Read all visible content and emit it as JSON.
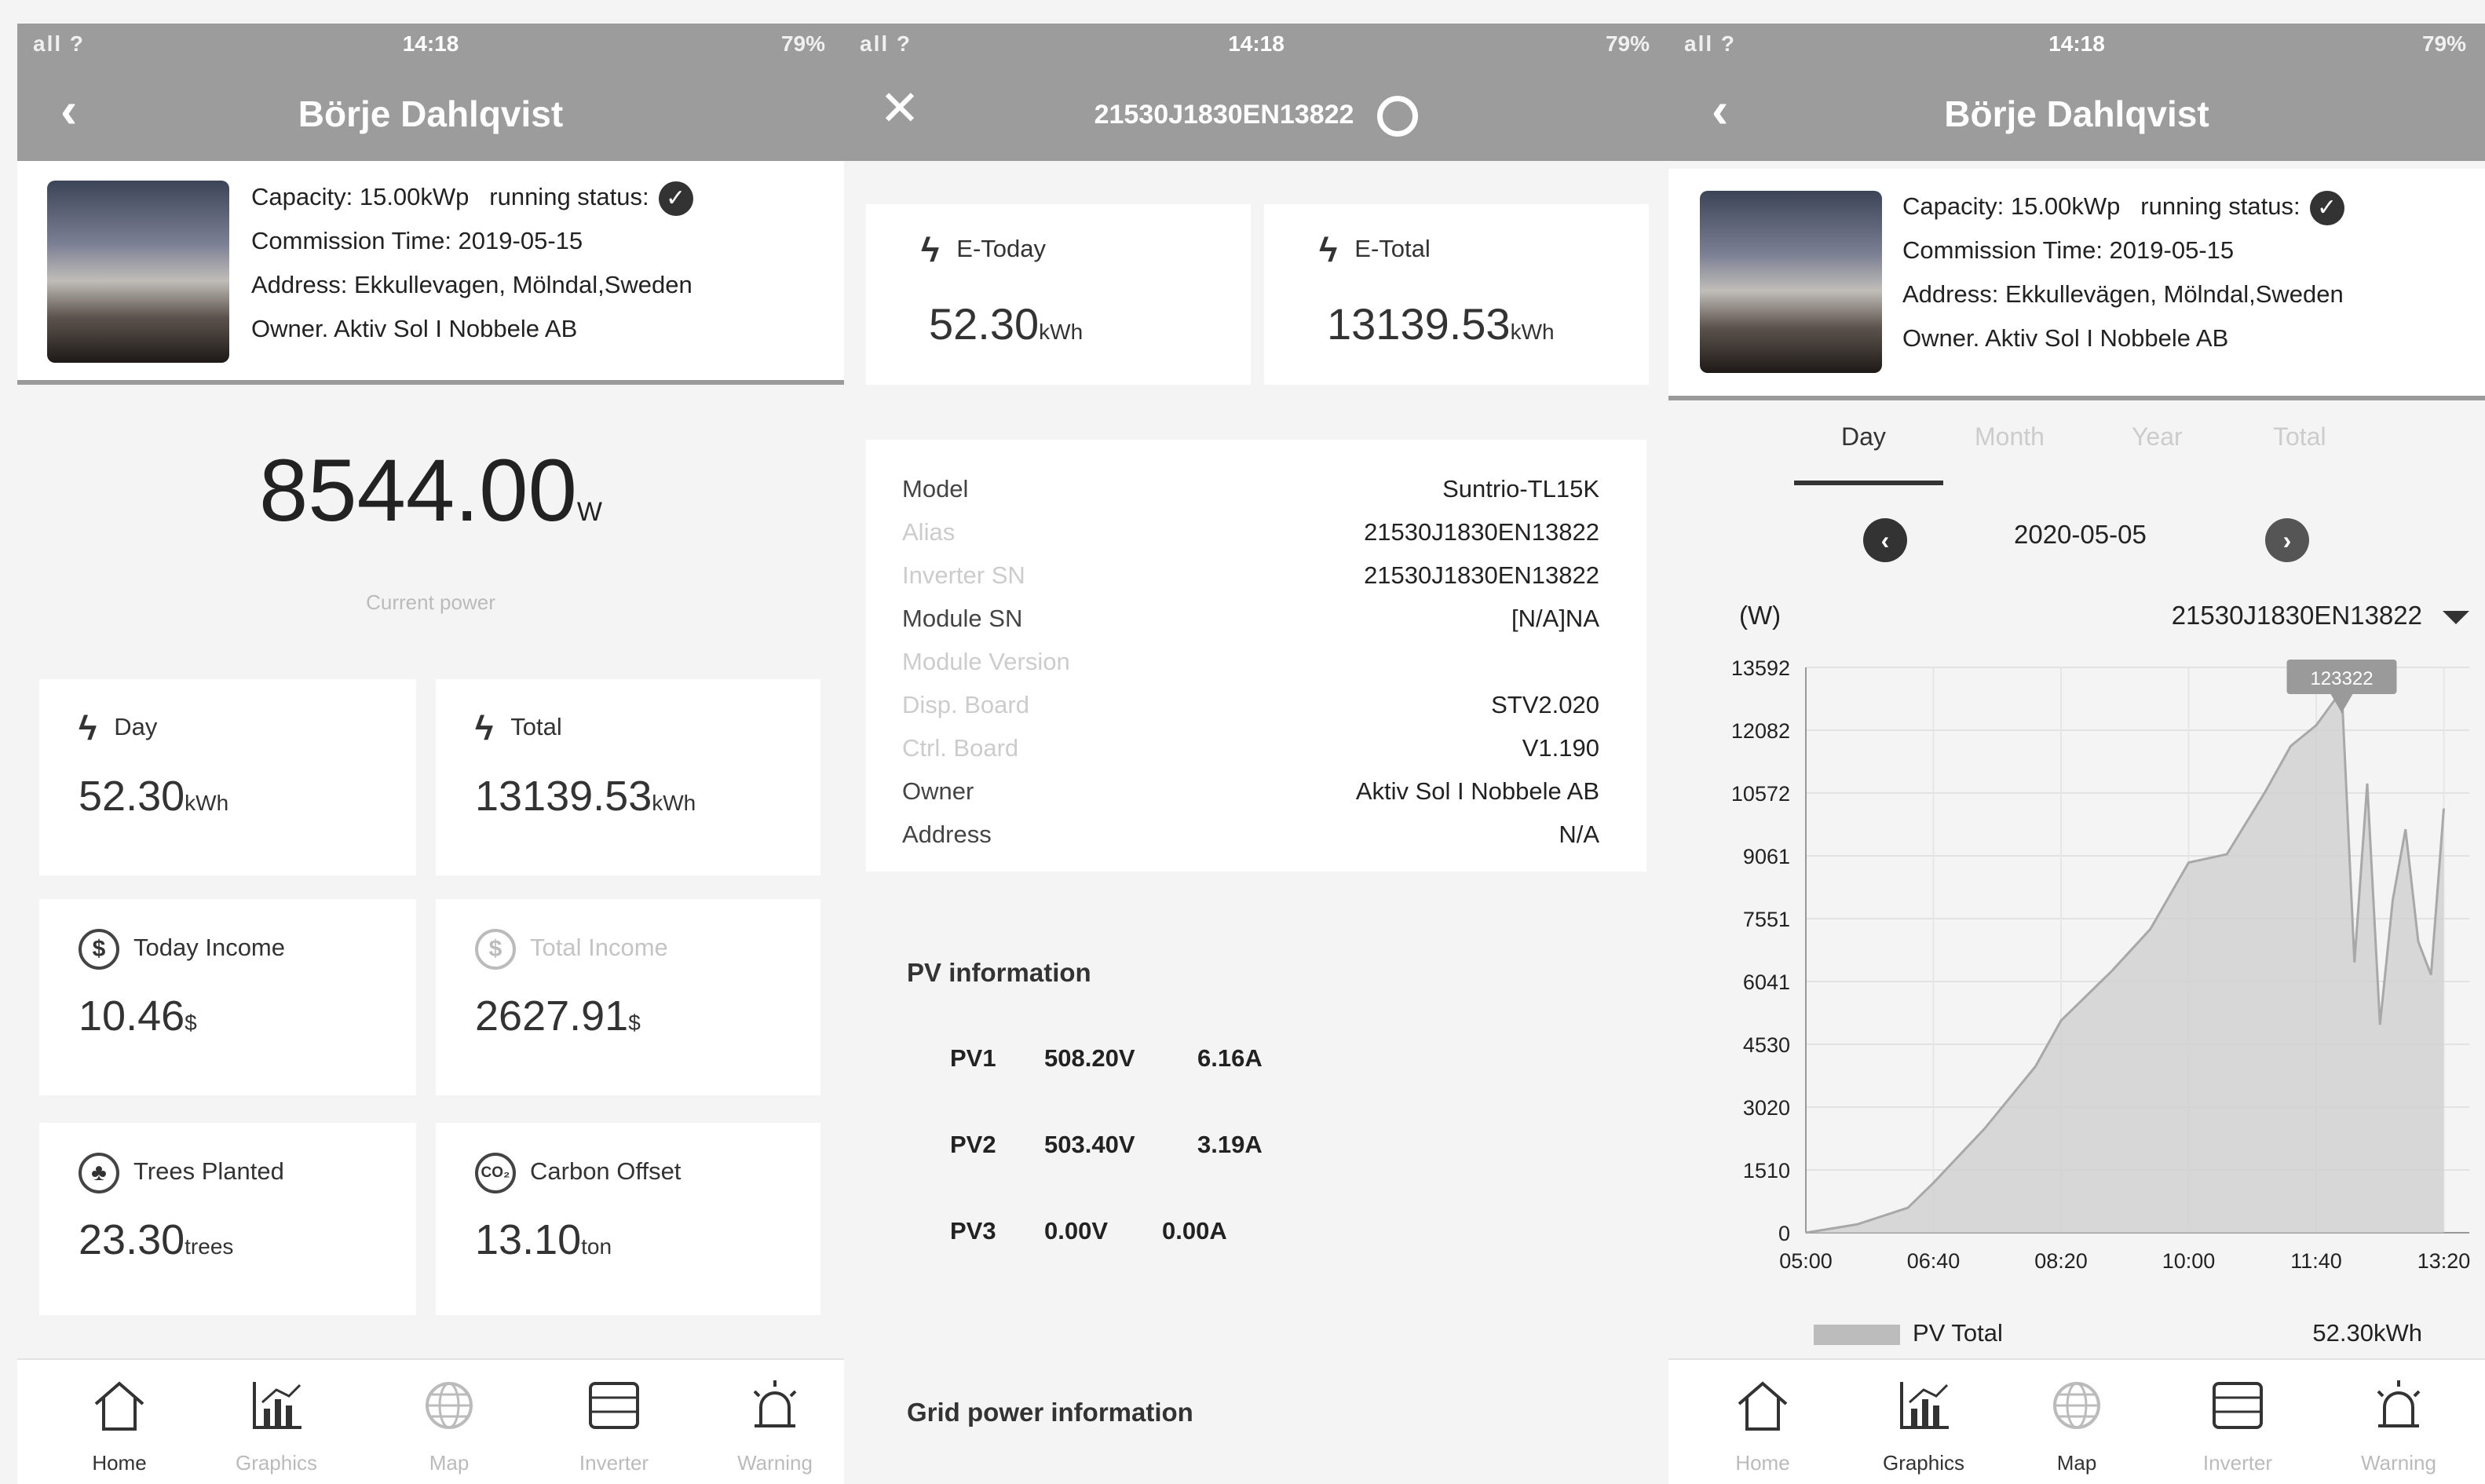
{
  "screen1": {
    "status": {
      "signal": "all ?",
      "time": "14:18",
      "right": "79%"
    },
    "title": "Börje Dahlqvist",
    "plant": {
      "capacity": "Capacity: 15.00kWp",
      "running_status_label": "running status:",
      "commission": "Commission Time: 2019-05-15",
      "address": "Address: Ekkullevagen, Mölndal,Sweden",
      "owner": "Owner. Aktiv Sol I Nobbele AB"
    },
    "current_power": {
      "value": "8544.00",
      "unit": "W",
      "label": "Current power"
    },
    "stats": [
      {
        "label": "Day",
        "value": "52.30",
        "unit": "kWh",
        "icon": "bolt-icon"
      },
      {
        "label": "Total",
        "value": "13139.53",
        "unit": "kWh",
        "icon": "bolt-icon"
      },
      {
        "label": "Today Income",
        "value": "10.46",
        "unit": "$",
        "icon": "dollar-icon"
      },
      {
        "label": "Total Income",
        "value": "2627.91",
        "unit": "$",
        "icon": "dollar-icon"
      },
      {
        "label": "Trees Planted",
        "value": "23.30",
        "unit": "trees",
        "icon": "tree-icon"
      },
      {
        "label": "Carbon Offset",
        "value": "13.10",
        "unit": "ton",
        "icon": "co2-icon"
      }
    ],
    "tabbar": [
      {
        "label": "Home",
        "icon": "home-icon"
      },
      {
        "label": "Graphics",
        "icon": "graphics-icon"
      },
      {
        "label": "Map",
        "icon": "globe-icon"
      },
      {
        "label": "Inverter",
        "icon": "inverter-icon"
      },
      {
        "label": "Warning",
        "icon": "alarm-icon"
      }
    ]
  },
  "screen2": {
    "status": {
      "signal": "all ?",
      "time": "14:18",
      "right": "79%"
    },
    "title": "21530J1830EN13822",
    "energy": [
      {
        "label": "E-Today",
        "value": "52.30",
        "unit": "kWh"
      },
      {
        "label": "E-Total",
        "value": "13139.53",
        "unit": "kWh"
      }
    ],
    "details": [
      {
        "key": "Model",
        "value": "Suntrio-TL15K"
      },
      {
        "key": "Alias",
        "value": "21530J1830EN13822"
      },
      {
        "key": "Inverter SN",
        "value": "21530J1830EN13822"
      },
      {
        "key": "Module SN",
        "value": "[N/A]NA"
      },
      {
        "key": "Module Version",
        "value": ""
      },
      {
        "key": "Disp. Board",
        "value": "STV2.020"
      },
      {
        "key": "Ctrl. Board",
        "value": "V1.190"
      },
      {
        "key": "Owner",
        "value": "Aktiv Sol I Nobbele AB"
      },
      {
        "key": "Address",
        "value": "N/A"
      }
    ],
    "pv_title": "PV information",
    "pv": [
      {
        "name": "PV1",
        "voltage": "508.20V",
        "current": "6.16A"
      },
      {
        "name": "PV2",
        "voltage": "503.40V",
        "current": "3.19A"
      },
      {
        "name": "PV3",
        "voltage": "0.00V",
        "current": "0.00A"
      }
    ],
    "grid_title": "Grid power information"
  },
  "screen3": {
    "status": {
      "signal": "all ?",
      "time": "14:18",
      "right": "79%"
    },
    "title": "Börje Dahlqvist",
    "plant": {
      "capacity": "Capacity: 15.00kWp",
      "running_status_label": "running status:",
      "commission": "Commission Time: 2019-05-15",
      "address": "Address: Ekkullevägen, Mölndal,Sweden",
      "owner": "Owner. Aktiv Sol I Nobbele AB"
    },
    "periods": [
      "Day",
      "Month",
      "Year",
      "Total"
    ],
    "date": "2020-05-05",
    "unit": "(W)",
    "device": "21530J1830EN13822",
    "legend": "PV Total",
    "total": "52.30kWh",
    "tabbar": [
      {
        "label": "Home",
        "icon": "home-icon"
      },
      {
        "label": "Graphics",
        "icon": "graphics-icon"
      },
      {
        "label": "Map",
        "icon": "globe-icon"
      },
      {
        "label": "Inverter",
        "icon": "inverter-icon"
      },
      {
        "label": "Warning",
        "icon": "alarm-icon"
      }
    ]
  },
  "chart_data": {
    "type": "area",
    "series": [
      {
        "name": "PV Total",
        "x": [
          "05:00",
          "05:40",
          "06:20",
          "06:40",
          "07:20",
          "08:00",
          "08:20",
          "09:00",
          "09:30",
          "10:00",
          "10:30",
          "11:00",
          "11:20",
          "11:40",
          "12:00",
          "12:10",
          "12:20",
          "12:30",
          "12:40",
          "12:50",
          "13:00",
          "13:10",
          "13:20"
        ],
        "values": [
          0,
          200,
          600,
          1200,
          2500,
          4000,
          5100,
          6300,
          7300,
          8900,
          9100,
          10600,
          11700,
          12200,
          13040,
          6500,
          10800,
          5000,
          8000,
          9700,
          7000,
          6200,
          10200
        ]
      }
    ],
    "yticks": [
      0,
      1510,
      3020,
      4530,
      6041,
      7551,
      9061,
      10572,
      12082,
      13592
    ],
    "xticks": [
      "05:00",
      "06:40",
      "08:20",
      "10:00",
      "11:40",
      "13:20"
    ],
    "xrange": [
      "05:00",
      "13:40"
    ],
    "ylim": [
      0,
      13592
    ],
    "peak_label": "123322",
    "grid": true,
    "colors": {
      "fill": "#d0d0d0",
      "line": "#a8a8a8",
      "peak": "#9a9a9a"
    }
  }
}
